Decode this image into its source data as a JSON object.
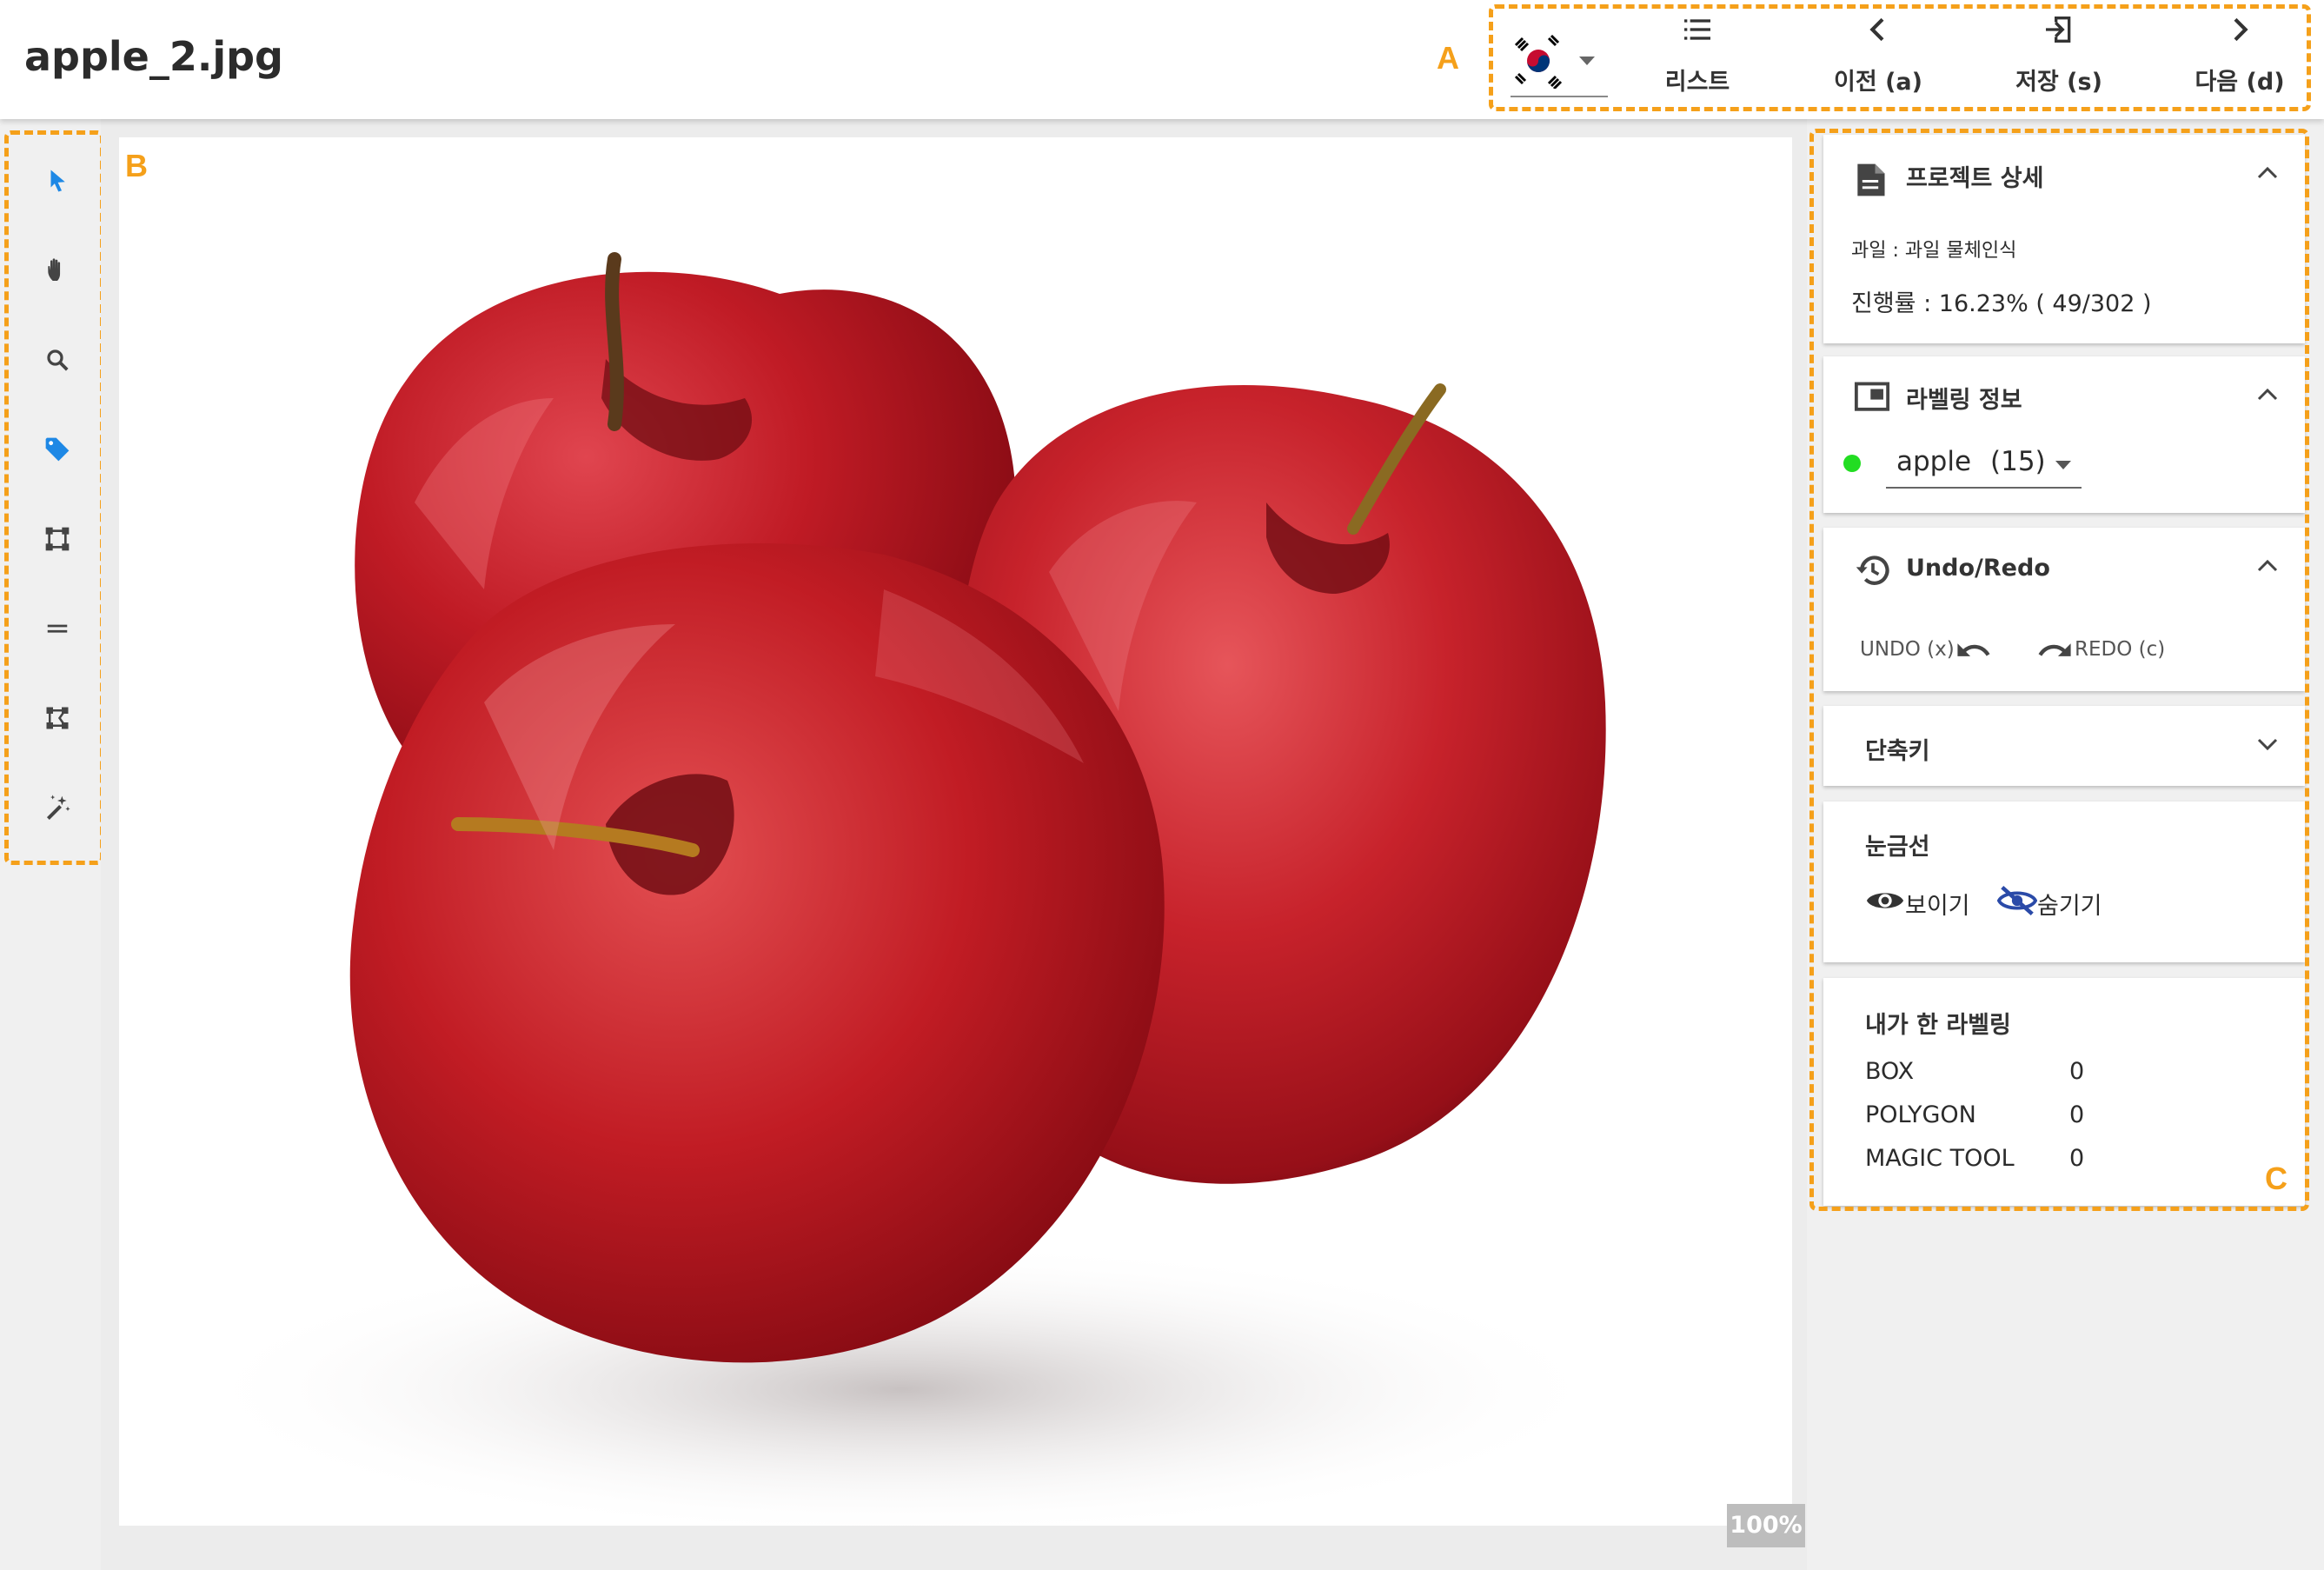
{
  "header": {
    "file_name": "apple_2.jpg",
    "callout_a": "A"
  },
  "language": {
    "selected": "flag-south-korea"
  },
  "nav": {
    "list_label": "리스트",
    "prev_label": "이전 (a)",
    "save_label": "저장 (s)",
    "next_label": "다음 (d)"
  },
  "tools": {
    "callout_b": "B",
    "items": [
      {
        "name": "select-cursor-icon",
        "active": true
      },
      {
        "name": "hand-pan-icon"
      },
      {
        "name": "magnifier-zoom-icon"
      },
      {
        "name": "tag-label-icon",
        "active": true
      },
      {
        "name": "bounding-box-icon"
      },
      {
        "name": "line-icon"
      },
      {
        "name": "polygon-icon"
      },
      {
        "name": "magic-wand-icon"
      }
    ]
  },
  "canvas": {
    "zoom": "100%",
    "image_subject": "three red apples"
  },
  "panel": {
    "callout_c": "C",
    "project": {
      "title": "프로젝트 상세",
      "category": "과일 : 과일 물체인식",
      "progress": "진행률 : 16.23% ( 49/302 )"
    },
    "labeling": {
      "title": "라벨링 정보",
      "selected_class": "apple",
      "selected_count": "(15)",
      "class_color": "#22dd22"
    },
    "undo_redo": {
      "title": "Undo/Redo",
      "undo_label": "UNDO (x)",
      "redo_label": "REDO (c)"
    },
    "shortcuts": {
      "title": "단축키"
    },
    "grid": {
      "title": "눈금선",
      "show_label": "보이기",
      "hide_label": "숨기기"
    },
    "my_labeling": {
      "title": "내가 한 라벨링",
      "rows": [
        {
          "name": "BOX",
          "count": "0"
        },
        {
          "name": "POLYGON",
          "count": "0"
        },
        {
          "name": "MAGIC TOOL",
          "count": "0"
        }
      ]
    }
  },
  "colors": {
    "accent_orange": "#f5a01a",
    "tool_blue": "#1e88e5",
    "apple_red": "#b5121b"
  }
}
